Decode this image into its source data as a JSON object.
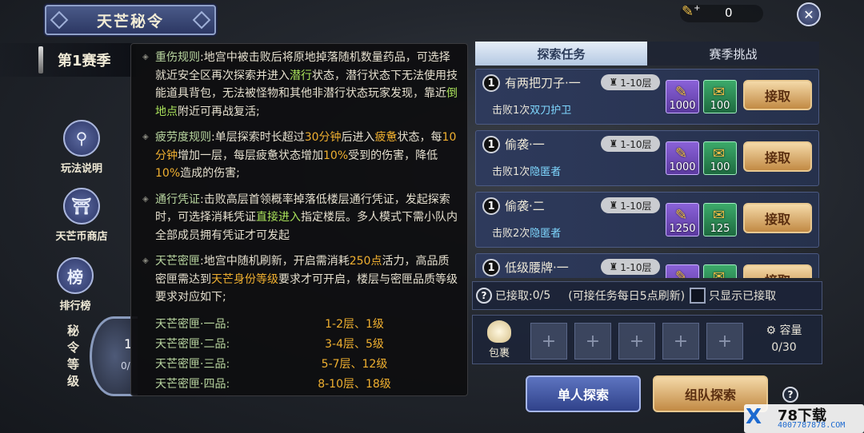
{
  "header": {
    "title": "天芒秘令",
    "season": "第1赛季",
    "currency_value": "0"
  },
  "sidebar": {
    "items": [
      {
        "label": "玩法说明",
        "icon": "scroll-icon"
      },
      {
        "label": "天芒币商店",
        "icon": "shop-icon"
      },
      {
        "label": "排行榜",
        "icon": "ranking-icon"
      }
    ],
    "rank_label": "秘令等级",
    "rank_level": "1",
    "rank_progress": "0/"
  },
  "rules": {
    "injury_title": "重伤规则",
    "injury_a": ":地宫中被击败后将原地掉落随机数量药品，可选择就近安全区再次探索并进入",
    "injury_stealth": "潜行",
    "injury_b": "状态，潜行状态下无法使用技能道具背包，无法被怪物和其他非潜行状态玩家发现，靠近",
    "injury_fallen": "倒地点",
    "injury_c": "附近可再战复活;",
    "fatigue_title": "疲劳度规则",
    "fatigue_a": ":单层探索时长超过",
    "fatigue_30": "30分钟",
    "fatigue_b": "后进入",
    "fatigue_word": "疲惫",
    "fatigue_c": "状态，每",
    "fatigue_10": "10分钟",
    "fatigue_d": "增加一层，每层疲惫状态增加",
    "fatigue_10p1": "10%",
    "fatigue_e": "受到的伤害，降低",
    "fatigue_10p2": "10%",
    "fatigue_f": "造成的伤害;",
    "pass_title": "通行凭证",
    "pass_a": ":击败高层首领概率掉落低楼层通行凭证，发起探索时，可选择消耗凭证",
    "pass_direct": "直接进入",
    "pass_b": "指定楼层。多人模式下需小队内全部成员拥有凭证才可发起",
    "box_title": "天芒密匣",
    "box_a": ":地宫中随机刷新，开启需消耗",
    "box_250": "250点",
    "box_b": "活力，高品质密匣需达到",
    "box_rank": "天芒身份等级",
    "box_c": "要求才可开启，楼层与密匣品质等级要求对应如下;",
    "tiers": [
      {
        "name": "天芒密匣·一品:",
        "value": "1-2层、1级"
      },
      {
        "name": "天芒密匣·二品:",
        "value": "3-4层、5级"
      },
      {
        "name": "天芒密匣·三品:",
        "value": "5-7层、12级"
      },
      {
        "name": "天芒密匣·四品:",
        "value": "8-10层、18级"
      }
    ]
  },
  "tabs": [
    {
      "label": "探索任务",
      "active": true
    },
    {
      "label": "赛季挑战",
      "active": false
    }
  ],
  "quests": [
    {
      "num": "1",
      "title": "有两把刀子·一",
      "floor": "1-10层",
      "task_prefix": "击败1次",
      "task_target": "双刀护卫",
      "reward1": "1000",
      "reward2": "100",
      "accept": "接取"
    },
    {
      "num": "1",
      "title": "偷袭·一",
      "floor": "1-10层",
      "task_prefix": "击败1次",
      "task_target": "隐匿者",
      "reward1": "1000",
      "reward2": "100",
      "accept": "接取"
    },
    {
      "num": "1",
      "title": "偷袭·二",
      "floor": "1-10层",
      "task_prefix": "击败2次",
      "task_target": "隐匿者",
      "reward1": "1250",
      "reward2": "125",
      "accept": "接取"
    },
    {
      "num": "1",
      "title": "低级腰牌·一",
      "floor": "1-10层",
      "task_prefix": "",
      "task_target": "",
      "reward1": "",
      "reward2": "",
      "accept": "接取"
    }
  ],
  "accepted": {
    "label": "已接取:",
    "count": "0/5",
    "note": "(可接任务每日5点刷新)",
    "filter_label": "只显示已接取"
  },
  "bag": {
    "label": "包裹",
    "slot_glyph": "+",
    "capacity_label": "容量",
    "capacity_value": "0/30"
  },
  "buttons": {
    "solo": "单人探索",
    "team": "组队探索",
    "help": "?"
  },
  "watermark": {
    "logo": "X",
    "title": "78下载",
    "url": "4007787878.COM"
  },
  "colors": {
    "highlight_green": "#a8e05a",
    "highlight_orange": "#f0b030",
    "target_blue": "#7fd8ff",
    "accept_gold": "#c28a44",
    "solo_blue": "#30428a"
  }
}
